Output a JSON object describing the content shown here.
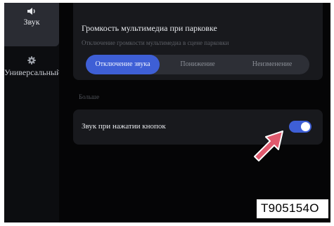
{
  "sidebar": {
    "items": [
      {
        "label": "Звук",
        "icon": "speaker-icon",
        "active": true
      },
      {
        "label": "Универсальный",
        "icon": "gear-icon",
        "active": false
      }
    ]
  },
  "media_volume": {
    "title": "Громкость мультимедиа при парковке",
    "subtitle": "Отключение громкости мультимедиа в сцене парковки",
    "options": [
      "Отключение звука",
      "Понижение",
      "Неизменение"
    ],
    "selected": "Отключение звука"
  },
  "more_section": {
    "label": "Больше"
  },
  "key_sound": {
    "label": "Звук при нажатии кнопок",
    "enabled": true
  },
  "annotation": {
    "arrow_color": "#e05a6e",
    "code": "T905154O"
  },
  "colors": {
    "accent": "#3e5fd6",
    "background": "#000000",
    "card": "#18191d"
  }
}
